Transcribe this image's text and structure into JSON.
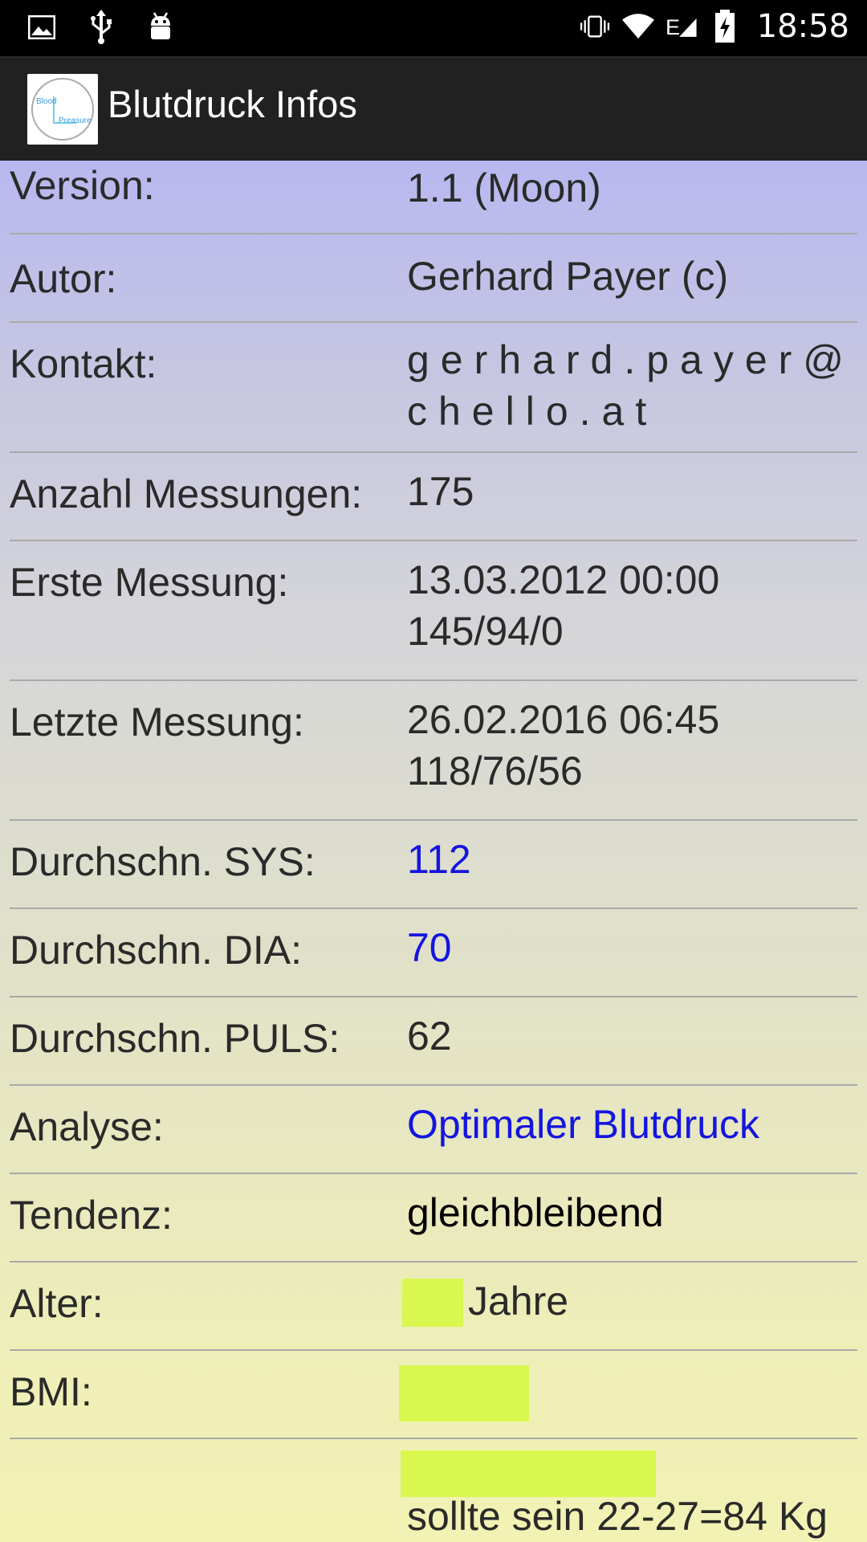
{
  "status_bar": {
    "time": "18:58",
    "left_icons": [
      "image-icon",
      "usb-icon",
      "android-icon"
    ],
    "right_icons": [
      "vibrate-icon",
      "wifi-icon",
      "network-e-icon",
      "battery-charging-icon"
    ]
  },
  "toolbar": {
    "logo_text_1": "Blood",
    "logo_text_2": "Preasure",
    "title": "Blutdruck Infos"
  },
  "rows": [
    {
      "label": "Version:",
      "value": "1.1 (Moon)"
    },
    {
      "label": "Autor:",
      "value": "Gerhard Payer (c)"
    },
    {
      "label": "Kontakt:",
      "value": "gerhard.payer@chello.at"
    },
    {
      "label": "Anzahl Messungen:",
      "value": "175"
    },
    {
      "label": "Erste Messung:",
      "value_line1": "13.03.2012 00:00",
      "value_line2": "145/94/0"
    },
    {
      "label": "Letzte Messung:",
      "value_line1": "26.02.2016 06:45",
      "value_line2": "118/76/56"
    },
    {
      "label": "Durchschn. SYS:",
      "value": "112"
    },
    {
      "label": "Durchschn. DIA:",
      "value": "70"
    },
    {
      "label": "Durchschn. PULS:",
      "value": "62"
    },
    {
      "label": "Analyse:",
      "value": "Optimaler Blutdruck"
    },
    {
      "label": "Tendenz:",
      "value": "gleichbleibend"
    },
    {
      "label": "Alter:",
      "value": "Jahre"
    },
    {
      "label": "BMI:",
      "value": ""
    },
    {
      "label": "",
      "value": "sollte sein 22-27=84 Kg"
    }
  ],
  "colors": {
    "value_highlight": "#1515e0",
    "redaction": "#d9f74f"
  }
}
